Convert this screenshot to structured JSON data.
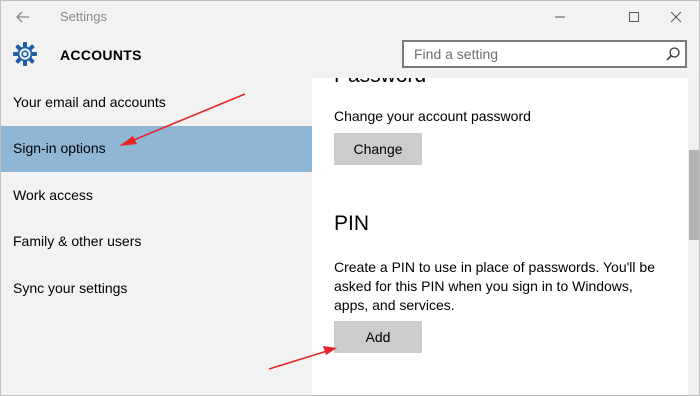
{
  "window": {
    "title": "Settings"
  },
  "header": {
    "title": "ACCOUNTS",
    "search_placeholder": "Find a setting"
  },
  "sidebar": {
    "items": [
      {
        "label": "Your email and accounts"
      },
      {
        "label": "Sign-in options",
        "selected": true
      },
      {
        "label": "Work access"
      },
      {
        "label": "Family & other users"
      },
      {
        "label": "Sync your settings"
      }
    ]
  },
  "content": {
    "password": {
      "heading": "Password",
      "description": "Change your account password",
      "button_label": "Change"
    },
    "pin": {
      "heading": "PIN",
      "description_lines": [
        "Create a PIN to use in place of passwords. You'll be",
        "asked for this PIN when you sign in to Windows,",
        "apps, and services."
      ],
      "button_label": "Add"
    }
  },
  "colors": {
    "selected_item": "#90b6d6",
    "button": "#cccccc",
    "sidebar_bg": "#f2f2f2",
    "annotation_arrow": "#e8262a"
  },
  "icons": [
    "back-arrow-icon",
    "minimize-icon",
    "maximize-icon",
    "close-icon",
    "gear-icon",
    "search-icon"
  ]
}
